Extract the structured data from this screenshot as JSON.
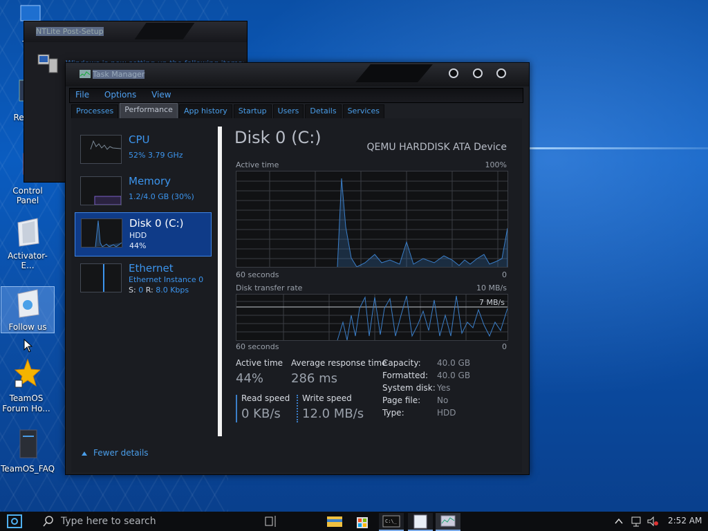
{
  "desktop": {
    "icons": [
      {
        "label": "Th",
        "id": "this-pc"
      },
      {
        "label": "Recy",
        "id": "recycle-bin"
      },
      {
        "label": "Control Panel",
        "id": "control-panel"
      },
      {
        "label": "Activator-E...",
        "id": "activator"
      },
      {
        "label": "Follow us",
        "id": "follow-us"
      },
      {
        "label": "TeamOS Forum Ho...",
        "id": "teamos-forum"
      },
      {
        "label": "TeamOS_FAQ",
        "id": "teamos-faq"
      }
    ]
  },
  "ntlite": {
    "title": "NTLite Post-Setup",
    "message": "Windows is now setting up the following items:"
  },
  "taskmanager": {
    "title": "Task Manager",
    "menu": [
      "File",
      "Options",
      "View"
    ],
    "tabs": [
      "Processes",
      "Performance",
      "App history",
      "Startup",
      "Users",
      "Details",
      "Services"
    ],
    "active_tab": "Performance",
    "side_items": [
      {
        "name": "CPU",
        "line1": "52%  3.79 GHz",
        "line2": ""
      },
      {
        "name": "Memory",
        "line1": "1.2/4.0 GB (30%)",
        "line2": ""
      },
      {
        "name": "Disk 0 (C:)",
        "line1": "HDD",
        "line2": "44%"
      },
      {
        "name": "Ethernet",
        "line1": "Ethernet Instance 0",
        "line2_s": "S:",
        "line2_sv": "0",
        "line2_r": "R:",
        "line2_rv": "8.0 Kbps"
      }
    ],
    "selected": "Disk 0 (C:)",
    "detail": {
      "title": "Disk 0 (C:)",
      "device": "QEMU HARDDISK ATA Device",
      "graph1": {
        "label": "Active time",
        "max": "100%",
        "xleft": "60 seconds",
        "xright": "0"
      },
      "graph2": {
        "label": "Disk transfer rate",
        "max": "10 MB/s",
        "line_label": "7 MB/s",
        "xleft": "60 seconds",
        "xright": "0"
      },
      "stats": {
        "active_time_label": "Active time",
        "active_time": "44%",
        "avg_resp_label": "Average response time",
        "avg_resp": "286 ms",
        "read_label": "Read speed",
        "read": "0 KB/s",
        "write_label": "Write speed",
        "write": "12.0 MB/s"
      },
      "props": [
        {
          "k": "Capacity:",
          "v": "40.0 GB"
        },
        {
          "k": "Formatted:",
          "v": "40.0 GB"
        },
        {
          "k": "System disk:",
          "v": "Yes"
        },
        {
          "k": "Page file:",
          "v": "No"
        },
        {
          "k": "Type:",
          "v": "HDD"
        }
      ]
    },
    "fewer_details": "Fewer details"
  },
  "taskbar": {
    "search_placeholder": "Type here to search",
    "clock": "2:52 AM"
  },
  "colors": {
    "accent": "#3c95ee",
    "selected_bg": "#0f3b88",
    "desktop": "#0a5cc0"
  }
}
